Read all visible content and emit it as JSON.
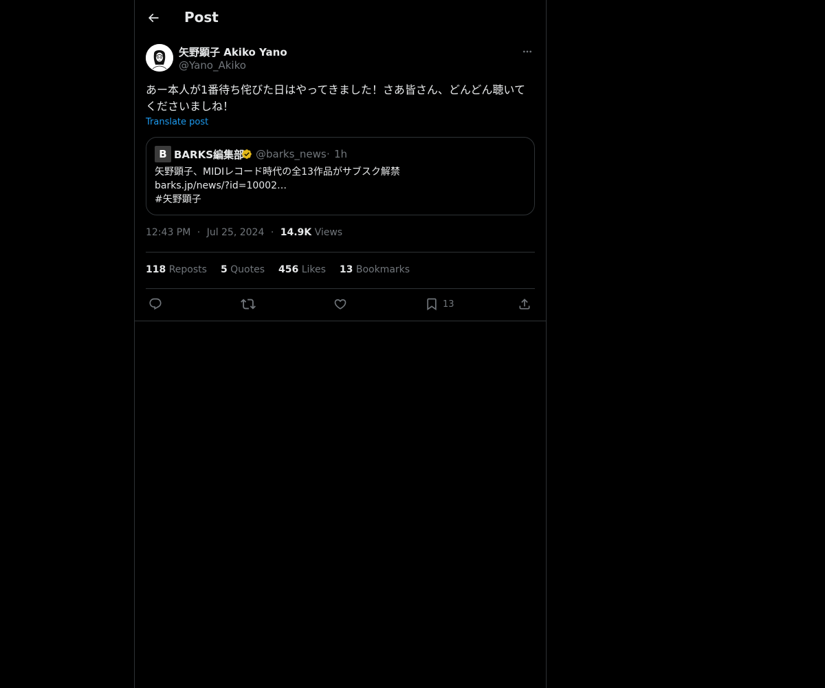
{
  "header": {
    "title": "Post"
  },
  "post": {
    "author_name": "矢野顕子 Akiko Yano",
    "author_handle": "@Yano_Akiko",
    "text": "あー本人が1番待ち侘びた日はやってきました！さあ皆さん、どんどん聴いてくださいましね！",
    "translate_label": "Translate post",
    "quote": {
      "avatar_letter": "B",
      "name": "BARKS編集部",
      "handle": "@barks_news",
      "separator": "·",
      "time": "1h",
      "lines": [
        "矢野顕子、MIDIレコード時代の全13作品がサブスク解禁",
        "barks.jp/news/?id=10002…",
        "#矢野顕子"
      ],
      "verified_color": "#e2b719"
    },
    "meta": {
      "time": "12:43 PM",
      "dot": "·",
      "date": "Jul 25, 2024",
      "views_count": "14.9K",
      "views_label": "Views"
    },
    "stats": [
      {
        "count": "118",
        "label": "Reposts"
      },
      {
        "count": "5",
        "label": "Quotes"
      },
      {
        "count": "456",
        "label": "Likes"
      },
      {
        "count": "13",
        "label": "Bookmarks"
      }
    ],
    "actions": {
      "reply_icon": "reply-icon",
      "repost_icon": "repost-icon",
      "like_icon": "heart-icon",
      "bookmark_icon": "bookmark-icon",
      "bookmark_count": "13",
      "share_icon": "share-icon"
    }
  },
  "colors": {
    "background": "#000000",
    "text": "#e7e9ea",
    "muted": "#71767b",
    "link": "#1d9bf0",
    "border": "#2f3336"
  }
}
